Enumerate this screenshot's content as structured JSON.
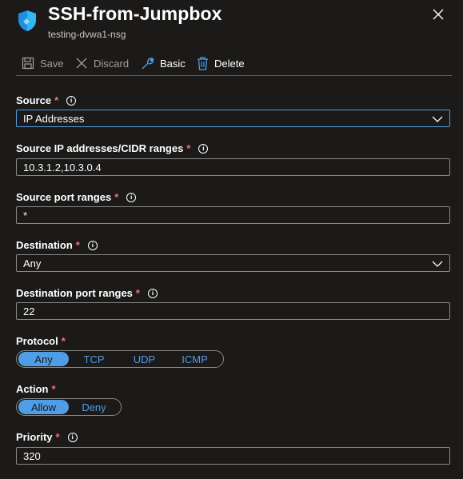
{
  "header": {
    "title": "SSH-from-Jumpbox",
    "subtitle": "testing-dvwa1-nsg"
  },
  "toolbar": {
    "save_label": "Save",
    "discard_label": "Discard",
    "basic_label": "Basic",
    "delete_label": "Delete"
  },
  "form": {
    "required_mark": "*",
    "info_glyph": "i",
    "source": {
      "label": "Source",
      "value": "IP Addresses"
    },
    "source_ip": {
      "label": "Source IP addresses/CIDR ranges",
      "value": "10.3.1.2,10.3.0.4"
    },
    "source_port": {
      "label": "Source port ranges",
      "value": "*"
    },
    "destination": {
      "label": "Destination",
      "value": "Any"
    },
    "destination_port": {
      "label": "Destination port ranges",
      "value": "22"
    },
    "protocol": {
      "label": "Protocol",
      "options": [
        "Any",
        "TCP",
        "UDP",
        "ICMP"
      ],
      "selected": "Any"
    },
    "action": {
      "label": "Action",
      "options": [
        "Allow",
        "Deny"
      ],
      "selected": "Allow"
    },
    "priority": {
      "label": "Priority",
      "value": "320"
    }
  },
  "colors": {
    "background": "#1b1a19",
    "accent": "#4f9de6",
    "required": "#f1707b",
    "border": "#8a8886",
    "disabled_text": "#a19f9d"
  },
  "icons": {
    "header": "shield-icon",
    "close": "close-icon",
    "save": "save-icon",
    "discard": "discard-icon",
    "basic": "wrench-icon",
    "delete": "trash-icon",
    "dropdown": "chevron-down-icon",
    "info": "info-icon"
  }
}
